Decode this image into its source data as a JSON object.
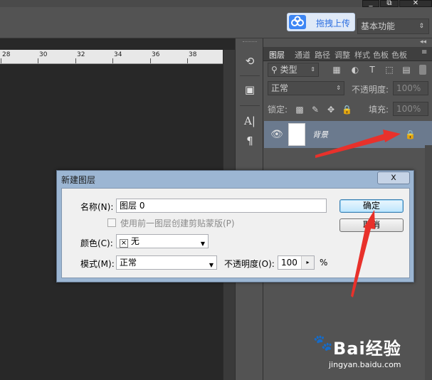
{
  "window": {
    "restore_glyph": "⧉",
    "close_glyph": "✕"
  },
  "options_bar": {
    "upload_button": "拖拽上传",
    "workspace": "基本功能"
  },
  "ruler": {
    "marks": [
      "28",
      "30",
      "32",
      "34",
      "36",
      "38"
    ]
  },
  "layers_panel": {
    "tabs": [
      "图层",
      "通道",
      "路径",
      "调整",
      "样式",
      "色板",
      "色板"
    ],
    "filter": {
      "kind": "类型",
      "icons": [
        "image-filter-icon",
        "adjustment-filter-icon",
        "type-filter-icon",
        "shape-filter-icon",
        "smart-object-filter-icon"
      ]
    },
    "blend_mode": "正常",
    "opacity": {
      "label": "不透明度:",
      "value": "100%"
    },
    "lock": {
      "label": "锁定:"
    },
    "fill": {
      "label": "填充:",
      "value": "100%"
    },
    "layer": {
      "name": "背景",
      "visible": true,
      "locked": true
    }
  },
  "dialog": {
    "title": "新建图层",
    "close_glyph": "x",
    "name_label": "名称(N):",
    "name_value": "图层 0",
    "clip_checkbox_label": "使用前一图层创建剪贴蒙版(P)",
    "clip_checked": false,
    "color_label": "颜色(C):",
    "color_value": "无",
    "mode_label": "模式(M):",
    "mode_value": "正常",
    "opacity_label": "不透明度(O):",
    "opacity_value": "100",
    "opacity_unit": "%",
    "ok_label": "确定",
    "cancel_label": "取消"
  },
  "watermark": {
    "brand": "Bai经验",
    "url": "jingyan.baidu.com"
  },
  "colors": {
    "accent_red": "#e8312b",
    "dialog_frame": "#9cb6d3",
    "panel_bg": "#535353",
    "layer_selected": "#6b7a8e"
  }
}
